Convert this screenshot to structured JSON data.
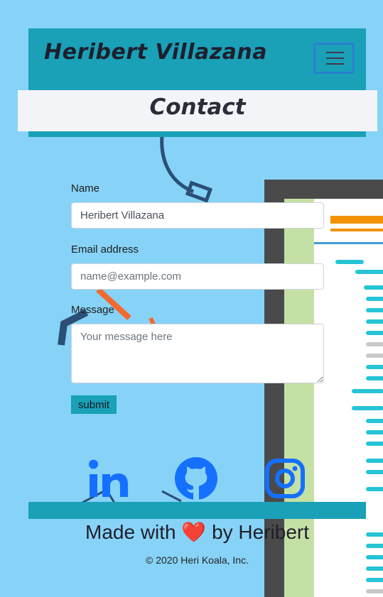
{
  "navbar": {
    "brand": "Heribert Villazana",
    "toggler_icon": "hamburger-icon"
  },
  "page_heading": "Contact",
  "form": {
    "name_label": "Name",
    "name_value": "Heribert Villazana",
    "email_label": "Email address",
    "email_placeholder": "name@example.com",
    "message_label": "Message",
    "message_placeholder": "Your message here",
    "submit_label": "submit"
  },
  "social": [
    "linkedin-icon",
    "github-icon",
    "instagram-icon"
  ],
  "footer": {
    "made_prefix": "Made with",
    "heart": "❤️",
    "made_suffix": "by Heribert",
    "copyright": "© 2020 Heri Koala, Inc."
  },
  "colors": {
    "background": "#87d3f8",
    "accent": "#1aa1b8",
    "icon_blue": "#1570ff",
    "heart": "#e0202a"
  }
}
